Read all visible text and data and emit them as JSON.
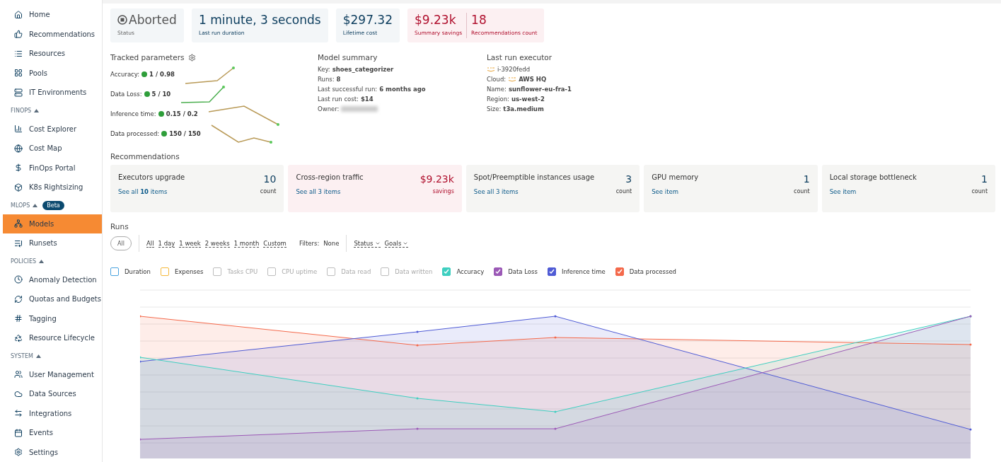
{
  "sidebar": {
    "groups": [
      {
        "items": [
          {
            "label": "Home",
            "selected": false
          },
          {
            "label": "Recommendations",
            "selected": false
          },
          {
            "label": "Resources",
            "selected": false
          },
          {
            "label": "Pools",
            "selected": false
          },
          {
            "label": "IT Environments",
            "selected": false
          }
        ]
      },
      {
        "title": "FINOPS",
        "items": [
          {
            "label": "Cost Explorer",
            "selected": false
          },
          {
            "label": "Cost Map",
            "selected": false
          },
          {
            "label": "FinOps Portal",
            "selected": false
          },
          {
            "label": "K8s Rightsizing",
            "selected": false
          }
        ]
      },
      {
        "title": "MLOPS",
        "badge": "Beta",
        "items": [
          {
            "label": "Models",
            "selected": true
          },
          {
            "label": "Runsets",
            "selected": false
          }
        ]
      },
      {
        "title": "POLICIES",
        "items": [
          {
            "label": "Anomaly Detection",
            "selected": false
          },
          {
            "label": "Quotas and Budgets",
            "selected": false
          },
          {
            "label": "Tagging",
            "selected": false
          },
          {
            "label": "Resource Lifecycle",
            "selected": false
          }
        ]
      },
      {
        "title": "SYSTEM",
        "items": [
          {
            "label": "User Management",
            "selected": false
          },
          {
            "label": "Data Sources",
            "selected": false
          },
          {
            "label": "Integrations",
            "selected": false
          },
          {
            "label": "Events",
            "selected": false
          },
          {
            "label": "Settings",
            "selected": false
          }
        ]
      }
    ]
  },
  "kpis": [
    {
      "kind": "status",
      "value": "Aborted",
      "label": "Status"
    },
    {
      "kind": "plain",
      "value": "1 minute, 3 seconds",
      "label": "Last run duration"
    },
    {
      "kind": "plain",
      "value": "$297.32",
      "label": "Lifetime cost"
    },
    {
      "kind": "split",
      "parts": [
        {
          "value": "$9.23k",
          "label": "Summary savings"
        },
        {
          "value": "18",
          "label": "Recommendations count"
        }
      ]
    }
  ],
  "tracked_parameters": {
    "title": "Tracked parameters",
    "items": [
      {
        "label": "Accuracy:",
        "value": "1 / 0.98",
        "color": "#2e9e3a"
      },
      {
        "label": "Data Loss:",
        "value": "5 / 10",
        "color": "#2e9e3a"
      },
      {
        "label": "Inference time:",
        "value": "0.15 / 0.2",
        "color": "#2e9e3a"
      },
      {
        "label": "Data processed:",
        "value": "150 / 150",
        "color": "#2e9e3a"
      }
    ]
  },
  "model_summary": {
    "title": "Model summary",
    "rows": [
      {
        "label": "Key:",
        "value": "shoes_categorizer"
      },
      {
        "label": "Runs:",
        "value": "8"
      },
      {
        "label": "Last successful run:",
        "value": "6 months ago"
      },
      {
        "label": "Last run cost:",
        "value": "$14"
      },
      {
        "label": "Owner:",
        "blurred": true
      }
    ]
  },
  "last_run_executor": {
    "title": "Last run executor",
    "rows": [
      {
        "value": "i-3920fedd",
        "aws": true,
        "bold": false
      },
      {
        "label": "Cloud:",
        "value": "AWS HQ",
        "aws": true,
        "bold": true
      },
      {
        "label": "Name:",
        "value": "sunflower-eu-fra-1",
        "bold": true
      },
      {
        "label": "Region:",
        "value": "us-west-2",
        "bold": true
      },
      {
        "label": "Size:",
        "value": "t3a.medium",
        "bold": true
      }
    ]
  },
  "recommendations": {
    "title": "Recommendations",
    "cards": [
      {
        "kind": "count",
        "title": "Executors upgrade",
        "link": "See all **10** items",
        "value": "10",
        "unit": "count"
      },
      {
        "kind": "savings",
        "title": "Cross-region traffic",
        "link": "See all 3 items",
        "value": "$9.23k",
        "unit": "savings"
      },
      {
        "kind": "count",
        "title": "Spot/Preemptible instances usage",
        "link": "See all 3 items",
        "value": "3",
        "unit": "count"
      },
      {
        "kind": "count",
        "title": "GPU memory",
        "link": "See item",
        "value": "1",
        "unit": "count"
      },
      {
        "kind": "count",
        "title": "Local storage bottleneck",
        "link": "See item",
        "value": "1",
        "unit": "count"
      }
    ]
  },
  "runs": {
    "title": "Runs",
    "all_button": "All",
    "periods": [
      "All",
      "1 day",
      "1 week",
      "2 weeks",
      "1 month",
      "Custom"
    ],
    "filters_label": "Filters:",
    "filters_value": "None",
    "dropdowns": [
      "Status",
      "Goals"
    ],
    "legend": [
      {
        "label": "Duration",
        "color": "#4aa3df",
        "checked": false,
        "disabled": false
      },
      {
        "label": "Expenses",
        "color": "#f5b93b",
        "checked": false,
        "disabled": false
      },
      {
        "label": "Tasks CPU",
        "color": "#bdbdbd",
        "checked": false,
        "disabled": true
      },
      {
        "label": "CPU uptime",
        "color": "#bdbdbd",
        "checked": false,
        "disabled": true
      },
      {
        "label": "Data read",
        "color": "#bdbdbd",
        "checked": false,
        "disabled": true
      },
      {
        "label": "Data written",
        "color": "#bdbdbd",
        "checked": false,
        "disabled": true
      },
      {
        "label": "Accuracy",
        "color": "#3ecfc0",
        "checked": true,
        "disabled": false
      },
      {
        "label": "Data Loss",
        "color": "#9b59b6",
        "checked": true,
        "disabled": false
      },
      {
        "label": "Inference time",
        "color": "#4f5bd5",
        "checked": true,
        "disabled": false
      },
      {
        "label": "Data processed",
        "color": "#f4694b",
        "checked": true,
        "disabled": false
      }
    ]
  }
}
